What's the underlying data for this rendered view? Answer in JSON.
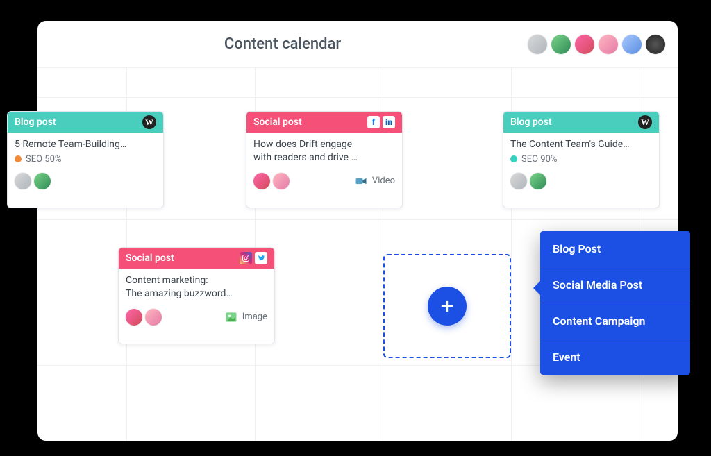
{
  "header": {
    "title": "Content calendar",
    "avatars": [
      {
        "cls": "av-gray"
      },
      {
        "cls": "av-green"
      },
      {
        "cls": "av-red"
      },
      {
        "cls": "av-pink"
      },
      {
        "cls": "av-blue"
      },
      {
        "cls": "av-dark"
      }
    ]
  },
  "colors": {
    "accent": "#1C4FE3",
    "teal": "#49CDBD",
    "pink": "#F55078",
    "seo50": "#F28C3B",
    "seo90": "#33D1C0"
  },
  "cards": {
    "blog1": {
      "type_label": "Blog post",
      "platform": "wordpress",
      "title": "5 Remote Team-Building…",
      "seo_label": "SEO 50%",
      "seo_color": "#F28C3B",
      "assignees": [
        "av-gray",
        "av-green"
      ]
    },
    "social1": {
      "type_label": "Social post",
      "networks": [
        "facebook",
        "linkedin"
      ],
      "title_l1": "How does Drift engage",
      "title_l2": "with readers and drive …",
      "media_label": "Video",
      "assignees": [
        "av-red",
        "av-pink"
      ]
    },
    "blog2": {
      "type_label": "Blog post",
      "platform": "wordpress",
      "title": "The Content Team's Guide…",
      "seo_label": "SEO 90%",
      "seo_color": "#33D1C0",
      "assignees": [
        "av-gray",
        "av-green"
      ]
    },
    "social2": {
      "type_label": "Social post",
      "networks": [
        "instagram",
        "twitter"
      ],
      "title_l1": "Content marketing:",
      "title_l2": "The amazing buzzword…",
      "media_label": "Image",
      "assignees": [
        "av-red",
        "av-pink"
      ]
    }
  },
  "menu": {
    "items": [
      "Blog Post",
      "Social Media Post",
      "Content Campaign",
      "Event"
    ]
  }
}
